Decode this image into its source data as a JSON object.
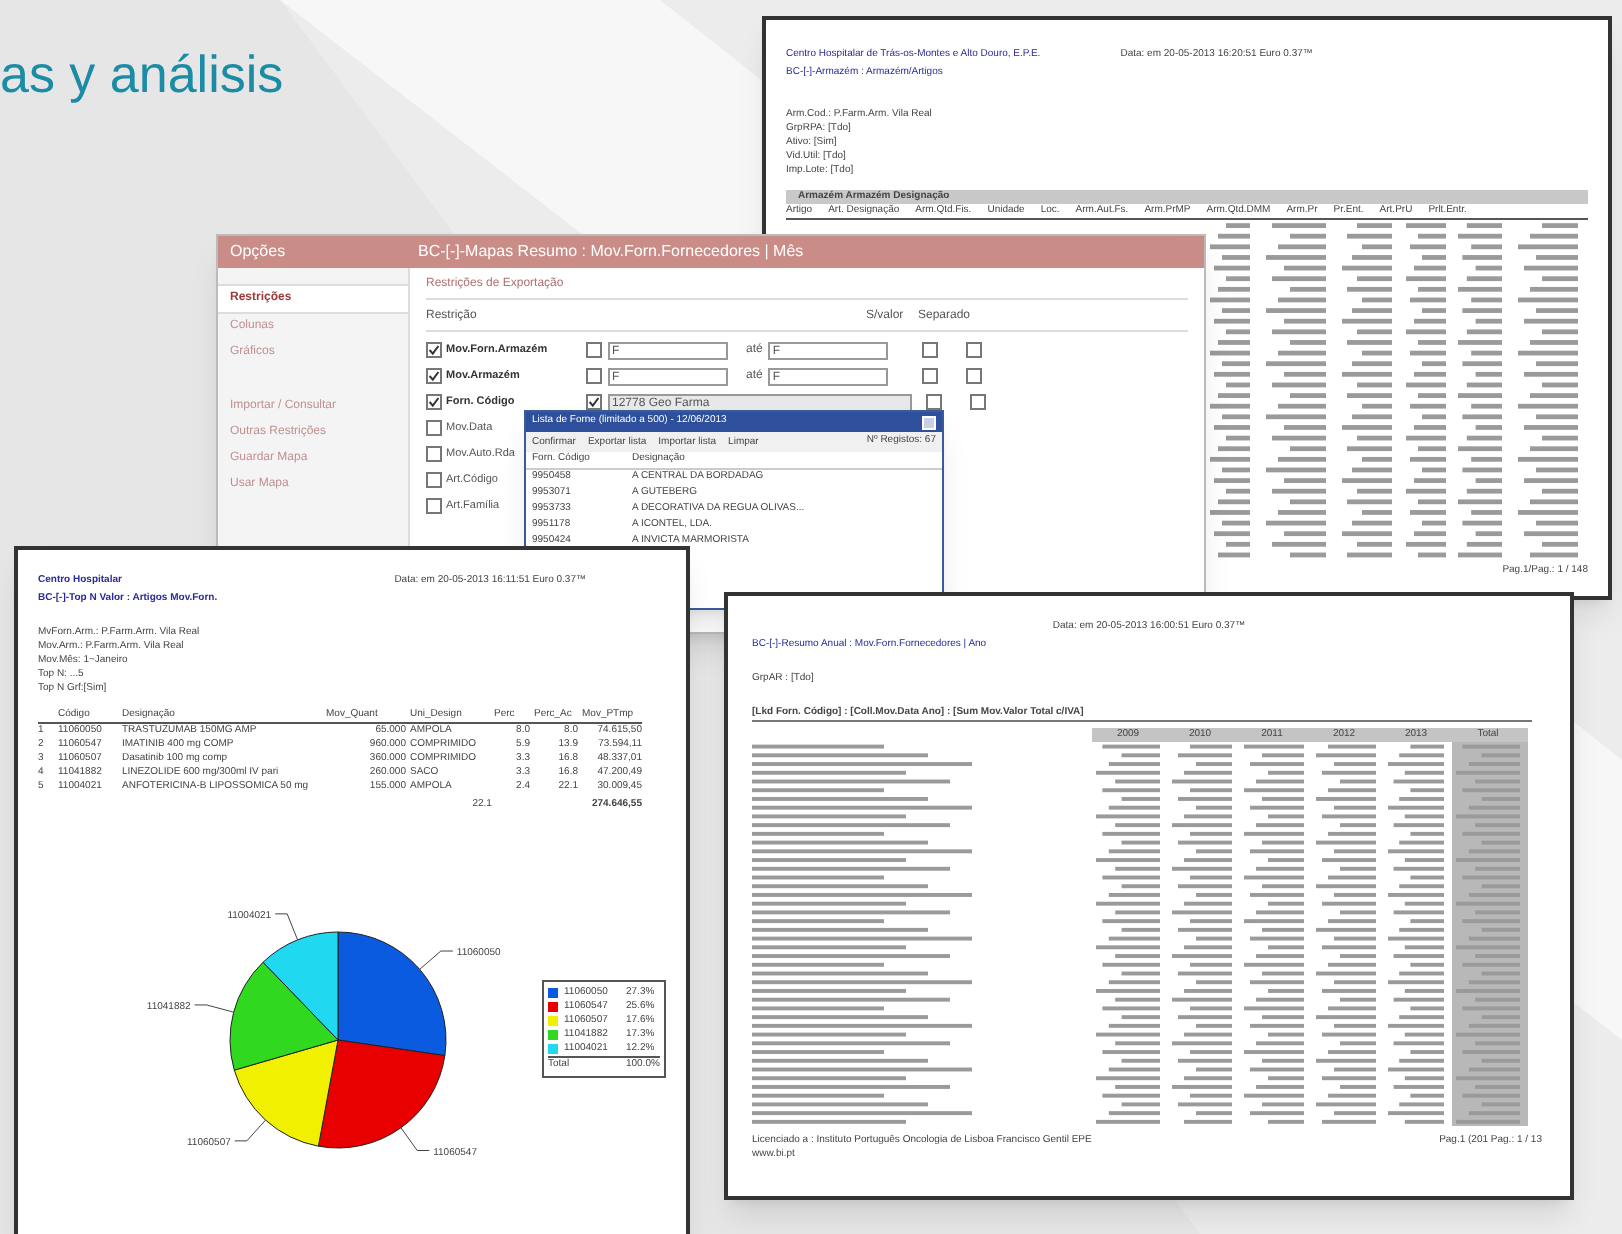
{
  "headline": "as y análisis",
  "armazem_report": {
    "org": "Centro Hospitalar de Trás-os-Montes e Alto Douro, E.P.E.",
    "date": "Data: em 20-05-2013 16:20:51 Euro 0.37™",
    "title": "BC-[-]-Armazém : Armazém/Artigos",
    "filters": [
      "Arm.Cod.: P.Farm.Arm. Vila Real",
      "GrpRPA: [Tdo]",
      "Ativo: [Sim]",
      "Vid.Util: [Tdo]",
      "Imp.Lote: [Tdo]"
    ],
    "group_header": "Armazém  Armazém Designação",
    "columns": [
      "Artigo",
      "Art. Designação",
      "Arm.Qtd.Fis.",
      "Unidade",
      "Loc.",
      "Arm.Aut.Fs.",
      "Arm.PrMP",
      "Arm.Qtd.DMM",
      "Arm.Pr",
      "Pr.Ent.",
      "Art.PrU",
      "Prlt.Entr."
    ],
    "footer": "Pag.1/Pag.: 1 / 148"
  },
  "options_window": {
    "left_title": "Opções",
    "title": "BC-[-]-Mapas Resumo : Mov.Forn.Fornecedores | Mês",
    "sidebar": [
      {
        "label": "Restrições",
        "selected": true
      },
      {
        "label": "Colunas",
        "selected": false
      },
      {
        "label": "Gráficos",
        "selected": false
      },
      {
        "label": "Importar / Consultar",
        "selected": false
      },
      {
        "label": "Outras Restrições",
        "selected": false
      },
      {
        "label": "Guardar Mapa",
        "selected": false
      },
      {
        "label": "Usar Mapa",
        "selected": false
      }
    ],
    "section": "Restrições de Exportação",
    "col_restriction": "Restrição",
    "col_novalue": "S/valor",
    "col_separate": "Separado",
    "restrictions": [
      {
        "label": "Mov.Forn.Armazém",
        "checked": true,
        "kind": "range",
        "flag_checked": false,
        "from": "F",
        "to_label": "até",
        "to": "F",
        "novalue_checked": false,
        "separate_checked": false
      },
      {
        "label": "Mov.Armazém",
        "checked": true,
        "kind": "range",
        "flag_checked": false,
        "from": "F",
        "to_label": "até",
        "to": "F",
        "novalue_checked": false,
        "separate_checked": false
      },
      {
        "label": "Forn. Código",
        "checked": true,
        "kind": "select",
        "flag_checked": true,
        "value": "12778 Geo Farma",
        "novalue_checked": false,
        "separate_checked": false
      },
      {
        "label": "Mov.Data",
        "checked": false,
        "kind": "plain"
      },
      {
        "label": "Mov.Auto.Rda",
        "checked": false,
        "kind": "plain"
      },
      {
        "label": "Art.Código",
        "checked": false,
        "kind": "plain"
      },
      {
        "label": "Art.Família",
        "checked": false,
        "kind": "plain"
      }
    ]
  },
  "list_dialog": {
    "title": "Lista de Forne (limitado a 500) - 12/06/2013",
    "toolbar": [
      "Confirmar",
      "Exportar lista",
      "Importar lista",
      "Limpar"
    ],
    "count": "Nº Registos: 67",
    "columns": [
      "Forn. Código",
      "Designação"
    ],
    "rows": [
      [
        "9950458",
        "A CENTRAL DA BORDADAG"
      ],
      [
        "9953071",
        "A GUTEBERG"
      ],
      [
        "9953733",
        "A DECORATIVA DA REGUA OLIVAS..."
      ],
      [
        "9951178",
        "A ICONTEL, LDA."
      ],
      [
        "9950424",
        "A INVICTA MARMORISTA"
      ]
    ]
  },
  "top_report": {
    "org": "Centro Hospitalar",
    "date": "Data: em 20-05-2013 16:11:51 Euro 0.37™",
    "title": "BC-[-]-Top N Valor : Artigos Mov.Forn.",
    "filters": [
      "MvForn.Arm.: P.Farm.Arm. Vila Real",
      "Mov.Arm.: P.Farm.Arm. Vila Real",
      "Mov.Mês: 1~Janeiro",
      "Top N: ...5",
      "Top N Grf:[Sim]"
    ],
    "columns": [
      "",
      "Código",
      "Designação",
      "Mov_Quant",
      "Uni_Design",
      "Perc",
      "Perc_Ac",
      "Mov_PTmp"
    ],
    "rows": [
      [
        "1",
        "11060050",
        "TRASTUZUMAB 150MG AMP",
        "65.000",
        "AMPOLA",
        "8.0",
        "8.0",
        "74.615,50"
      ],
      [
        "2",
        "11060547",
        "IMATINIB 400 mg COMP",
        "960.000",
        "COMPRIMIDO",
        "5.9",
        "13.9",
        "73.594,11"
      ],
      [
        "3",
        "11060507",
        "Dasatinib 100 mg comp",
        "360.000",
        "COMPRIMIDO",
        "3.3",
        "16.8",
        "48.337,01"
      ],
      [
        "4",
        "11041882",
        "LINEZOLIDE 600 mg/300ml IV pari",
        "260.000",
        "SACO",
        "3.3",
        "16.8",
        "47.200,49"
      ],
      [
        "5",
        "11004021",
        "ANFOTERICINA-B LIPOSSOMICA 50 mg",
        "155.000",
        "AMPOLA",
        "2.4",
        "22.1",
        "30.009,45"
      ]
    ],
    "total_perc": "22.1",
    "total_value": "274.646,55",
    "chart_data": {
      "type": "pie",
      "categories": [
        "11060050",
        "11060547",
        "11060507",
        "11041882",
        "11004021"
      ],
      "series": [
        {
          "values": [
            27.3,
            25.6,
            17.6,
            17.3,
            12.2
          ]
        }
      ]
    },
    "legend": [
      {
        "code": "11060050",
        "pct": "27.3%",
        "color": "#0a5be0"
      },
      {
        "code": "11060547",
        "pct": "25.6%",
        "color": "#e80000"
      },
      {
        "code": "11060507",
        "pct": "17.6%",
        "color": "#f0f000"
      },
      {
        "code": "11041882",
        "pct": "17.3%",
        "color": "#30d820"
      },
      {
        "code": "11004021",
        "pct": "12.2%",
        "color": "#20d8f0"
      }
    ],
    "legend_total": {
      "label": "Total",
      "pct": "100.0%"
    }
  },
  "annual_report": {
    "date": "Data: em 20-05-2013 16:00:51 Euro 0.37™",
    "title": "BC-[-]-Resumo Anual : Mov.Forn.Fornecedores | Ano",
    "filter": "GrpAR : [Tdo]",
    "axis": "[Lkd Forn. Código] : [Coll.Mov.Data Ano] : [Sum Mov.Valor Total c/IVA]",
    "years": [
      "2009",
      "2010",
      "2011",
      "2012",
      "2013",
      "Total"
    ],
    "license": "Licenciado a : Instituto Português Oncologia de Lisboa Francisco Gentil EPE",
    "site": "www.bi.pt",
    "footer": "Pag.1 (201 Pag.: 1 / 13"
  }
}
